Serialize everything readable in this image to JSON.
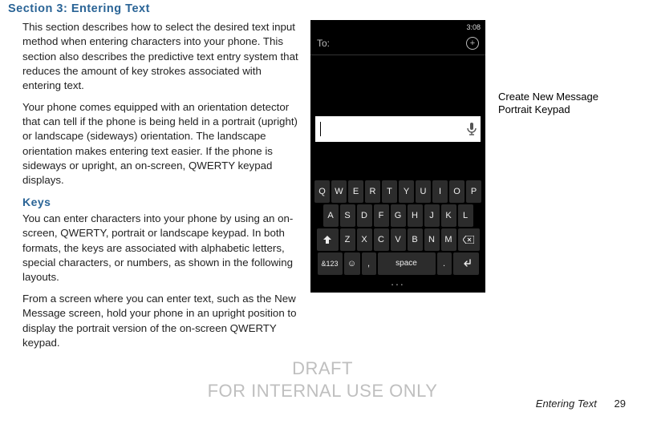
{
  "section": {
    "title": "Section 3: Entering Text",
    "para1": "This section describes how to select the desired text input method when entering characters into your phone. This section also describes the predictive text entry system that reduces the amount of key strokes associated with entering text.",
    "para2": "Your phone comes equipped with an orientation detector that can tell if the phone is being held in a portrait (upright) or landscape (sideways) orientation. The landscape orientation makes entering text easier. If the phone is sideways or upright, an on-screen, QWERTY keypad displays.",
    "keys_heading": "Keys",
    "para3": "You can enter characters into your phone by using an on-screen, QWERTY, portrait or landscape keypad. In both formats, the keys are associated with alphabetic letters, special characters, or numbers, as shown in the following layouts.",
    "para4": "From a screen where you can enter text, such as the New Message screen, hold your phone in an upright position to display the portrait version of the on-screen QWERTY keypad."
  },
  "phone": {
    "time": "3:08",
    "to_label": "To:",
    "plus_glyph": "+",
    "keyboard": {
      "row1": [
        "Q",
        "W",
        "E",
        "R",
        "T",
        "Y",
        "U",
        "I",
        "O",
        "P"
      ],
      "row2": [
        "A",
        "S",
        "D",
        "F",
        "G",
        "H",
        "J",
        "K",
        "L"
      ],
      "row3_letters": [
        "Z",
        "X",
        "C",
        "V",
        "B",
        "N",
        "M"
      ],
      "numsym_label": "&123",
      "emoji_glyph": "☺",
      "comma": ",",
      "space_label": "space",
      "dot": "."
    },
    "dots": "..."
  },
  "caption": {
    "line1": "Create New Message",
    "line2": "Portrait Keypad"
  },
  "watermark": {
    "line1": "DRAFT",
    "line2": "FOR INTERNAL USE ONLY"
  },
  "footer": {
    "chapter": "Entering Text",
    "page": "29"
  }
}
